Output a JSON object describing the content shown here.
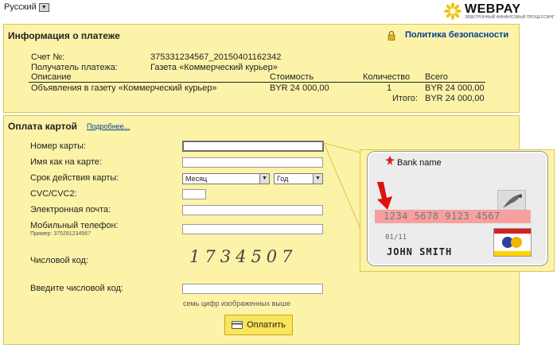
{
  "header": {
    "language": "Русский",
    "brand_name": "WEBPAY",
    "brand_sub": "ЭЛЕКТРОННЫЙ ФИНАНСОВЫЙ ПРОЦЕССИНГ"
  },
  "info": {
    "title": "Информация о платеже",
    "policy_link": "Политика безопасности",
    "account_label": "Счет №:",
    "account_value": "375331234567_20150401162342",
    "recipient_label": "Получатель платежа:",
    "recipient_value": "Газета «Коммерческий курьер»",
    "table": {
      "headers": [
        "Описание",
        "Стоимость",
        "Количество",
        "Всего"
      ],
      "rows": [
        [
          "Объявления в газету «Коммерческий курьер»",
          "BYR 24 000,00",
          "1",
          "BYR 24 000,00"
        ]
      ],
      "total_label": "Итого:",
      "total_value": "BYR 24 000,00"
    }
  },
  "payment": {
    "title": "Оплата картой",
    "more_link": "Подробнее...",
    "fields": {
      "card_number": "Номер карты:",
      "name_on_card": "Имя как на карте:",
      "expiry": "Срок действия карты:",
      "cvc": "CVC/CVC2:",
      "email": "Электронная почта:",
      "phone": "Мобильный телефон:",
      "phone_hint": "Пример: 375291234567",
      "captcha_label": "Числовой код:",
      "captcha_value": "1734507",
      "captcha_input": "Введите числовой код:",
      "captcha_hint": "семь цифр изображенных выше"
    },
    "month_option": "Месяц",
    "year_option": "Год",
    "pay_button": "Оплатить"
  },
  "card_example": {
    "bank_name": "Bank name",
    "number": "1234 5678 9123 4567",
    "expiry": "01/11",
    "holder": "JOHN SMITH"
  }
}
